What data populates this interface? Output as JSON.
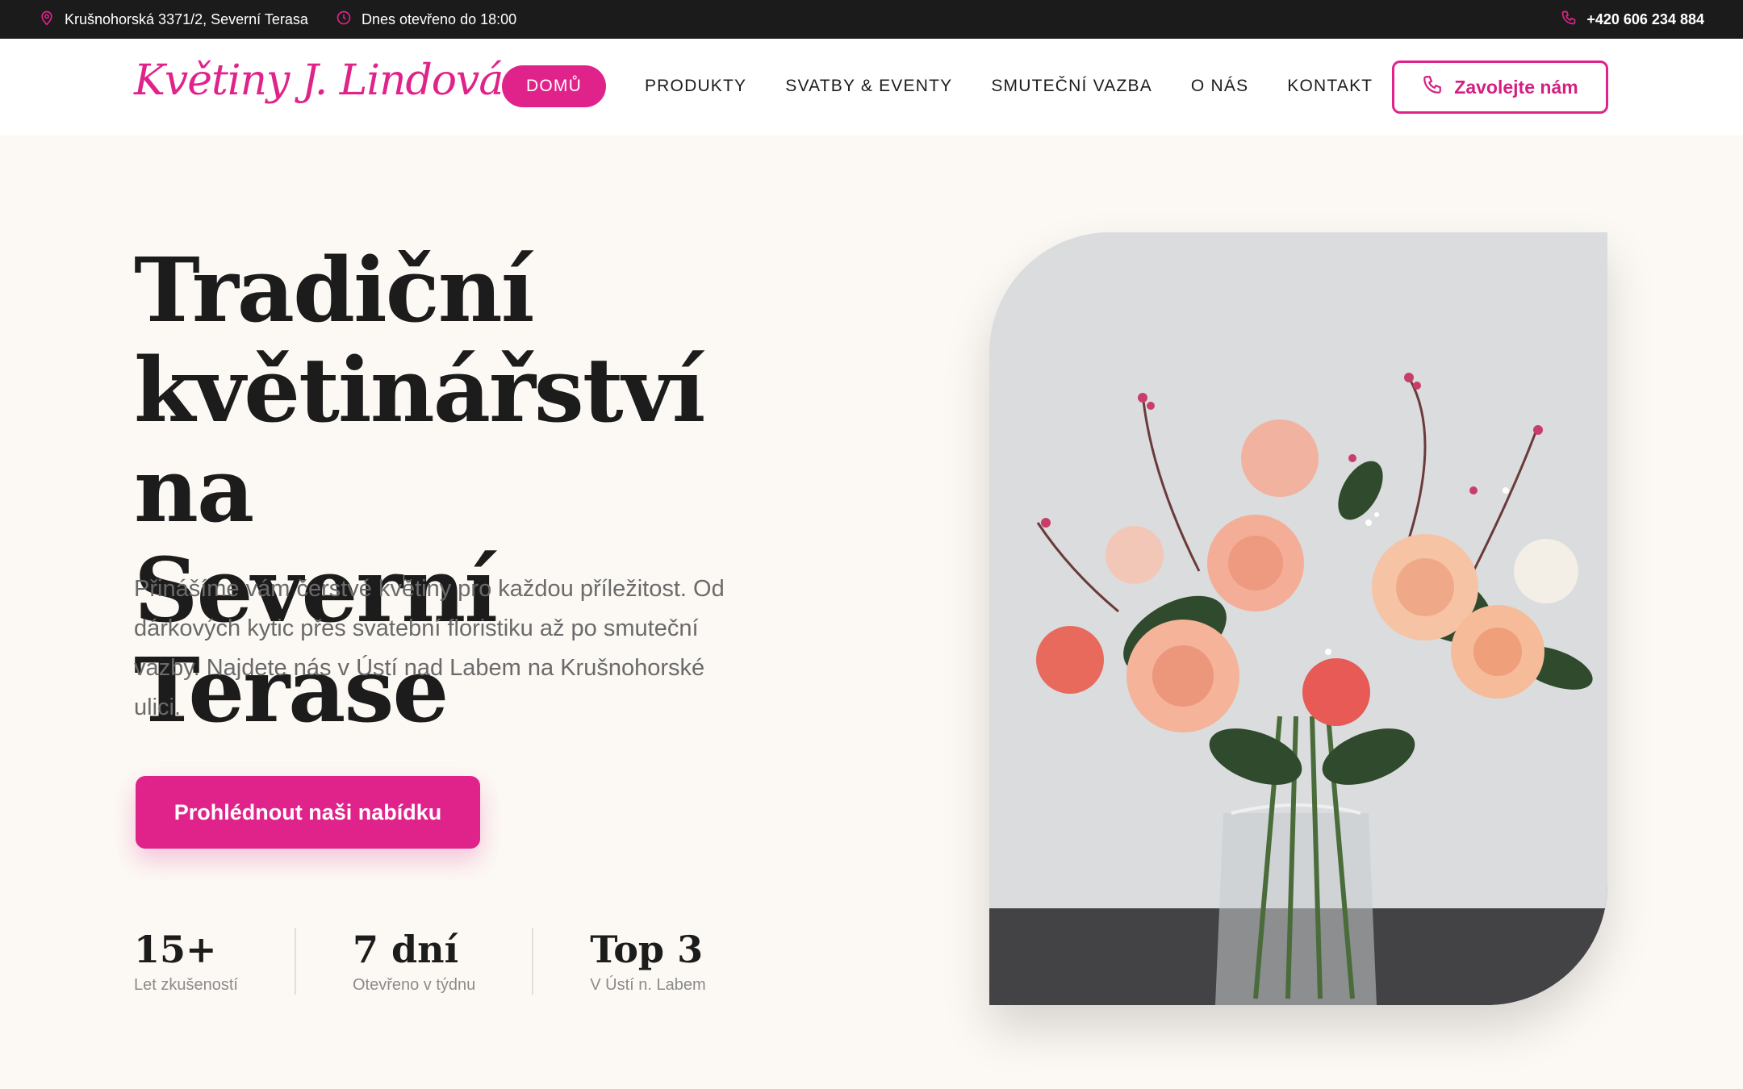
{
  "topbar": {
    "address": "Krušnohorská 3371/2, Severní Terasa",
    "hours": "Dnes otevřeno do 18:00",
    "phone": "+420 606 234 884"
  },
  "header": {
    "logo": "Květiny J. Lindová",
    "nav": [
      "DOMŮ",
      "PRODUKTY",
      "SVATBY & EVENTY",
      "SMUTEČNÍ VAZBA",
      "O NÁS",
      "KONTAKT"
    ],
    "call_label": "Zavolejte nám"
  },
  "hero": {
    "headline": [
      "Tradiční",
      "květinářství na",
      "Severní Terase"
    ],
    "lead": "Přinášíme vám čerstvé květiny pro každou příležitost. Od dárkových kytic přes svatební floristiku až po smuteční vazby. Najdete nás v Ústí nad Labem na Krušnohorské ulici.",
    "cta_label": "Prohlédnout naši nabídku",
    "stats": [
      {
        "value": "15+",
        "label": "Let zkušeností"
      },
      {
        "value": "7 dní",
        "label": "Otevřeno v týdnu"
      },
      {
        "value": "Top 3",
        "label": "V Ústí n. Labem"
      }
    ]
  },
  "colors": {
    "accent": "#e0238a",
    "topbar": "#1b1b1b",
    "background": "#fcf9f4"
  }
}
